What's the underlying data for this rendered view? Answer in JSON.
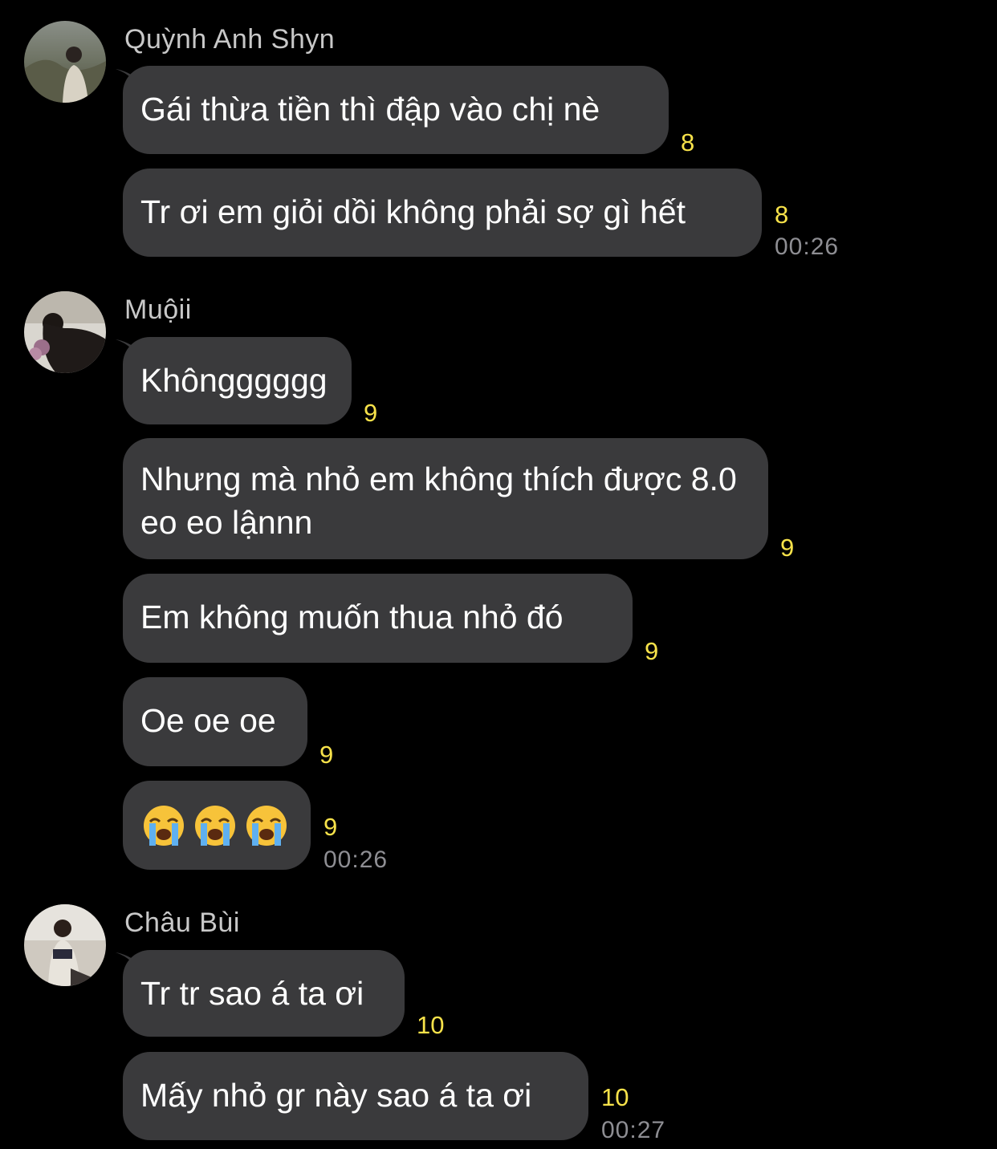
{
  "colors": {
    "background": "#000000",
    "bubble": "#3a3a3c",
    "read_count": "#f7e24a",
    "timestamp": "#8e8e93",
    "sender_name": "#c8c8c8"
  },
  "groups": [
    {
      "sender": "Quỳnh Anh Shyn",
      "avatar_icon": "user-avatar-photo",
      "messages": [
        {
          "text": "Gái thừa tiền thì đập vào chị nè",
          "read_count": "8"
        },
        {
          "text": "Tr ơi em giỏi dồi không phải sợ gì hết",
          "read_count": "8"
        }
      ],
      "time": "00:26"
    },
    {
      "sender": "Muộii",
      "avatar_icon": "user-avatar-photo",
      "messages": [
        {
          "text": "Khôngggggg",
          "read_count": "9"
        },
        {
          "text": "Nhưng mà nhỏ em không thích được 8.0 eo eo lậnnn",
          "read_count": "9"
        },
        {
          "text": "Em không muốn thua nhỏ đó",
          "read_count": "9"
        },
        {
          "text": "Oe oe oe",
          "read_count": "9"
        },
        {
          "emojis": [
            "loudly-crying-face-emoji",
            "loudly-crying-face-emoji",
            "loudly-crying-face-emoji"
          ],
          "read_count": "9"
        }
      ],
      "time": "00:26"
    },
    {
      "sender": "Châu Bùi",
      "avatar_icon": "user-avatar-photo",
      "messages": [
        {
          "text": "Tr tr sao á ta ơi",
          "read_count": "10"
        },
        {
          "text": "Mấy nhỏ gr này sao á ta ơi",
          "read_count": "10"
        }
      ],
      "time": "00:27"
    }
  ]
}
